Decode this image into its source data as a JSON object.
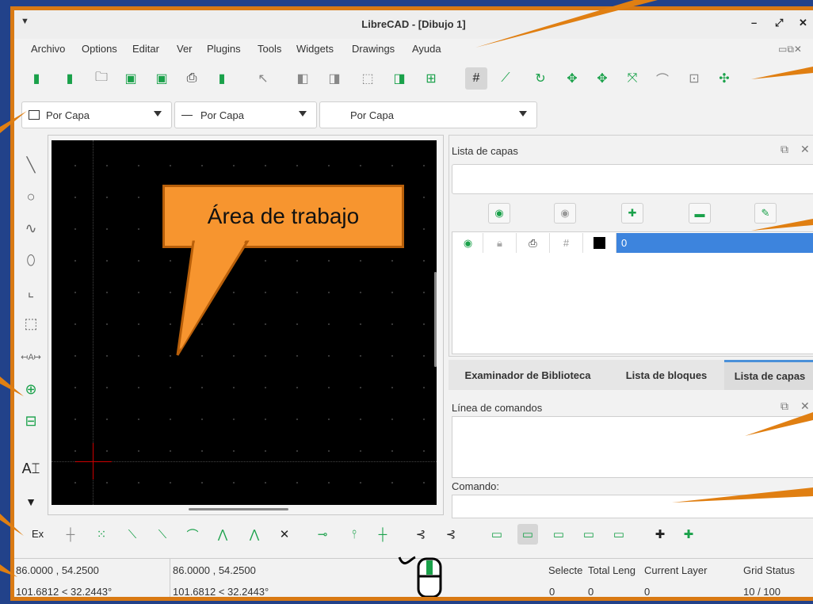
{
  "window": {
    "title": "LibreCAD - [Dibujo 1]",
    "controls": [
      "–",
      "⤢",
      "✕"
    ]
  },
  "menu": [
    "Archivo",
    "Options",
    "Editar",
    "Ver",
    "Plugins",
    "Tools",
    "Widgets",
    "Drawings",
    "Ayuda"
  ],
  "pen_bar": {
    "color": "Por Capa",
    "width": "Por Capa",
    "type": "Por Capa"
  },
  "canvas": {
    "callout": "Área de trabajo"
  },
  "layers_panel": {
    "title": "Lista de capas",
    "rows": [
      {
        "name": "0",
        "selected": true
      }
    ]
  },
  "tabs": [
    {
      "label": "Examinador de Biblioteca",
      "active": false
    },
    {
      "label": "Lista de bloques",
      "active": false
    },
    {
      "label": "Lista de capas",
      "active": true
    }
  ],
  "command_panel": {
    "title": "Línea de comandos",
    "prompt_label": "Comando:"
  },
  "snap_bar": {
    "exclusive_label": "Ex"
  },
  "status": {
    "abs_coord": "86.0000 , 54.2500",
    "abs_polar": "101.6812 < 32.2443°",
    "rel_coord": "86.0000 , 54.2500",
    "rel_polar": "101.6812 < 32.2443°",
    "selected_label": "Selecte",
    "selected_value": "0",
    "total_length_label": "Total Leng",
    "total_length_value": "0",
    "current_layer_label": "Current Layer",
    "current_layer_value": "0",
    "grid_label": "Grid Status",
    "grid_value": "10 / 100"
  },
  "colors": {
    "accent": "#f7952f",
    "selection": "#3d84dd",
    "icon_green": "#1aa14a",
    "background": "#22428a"
  }
}
